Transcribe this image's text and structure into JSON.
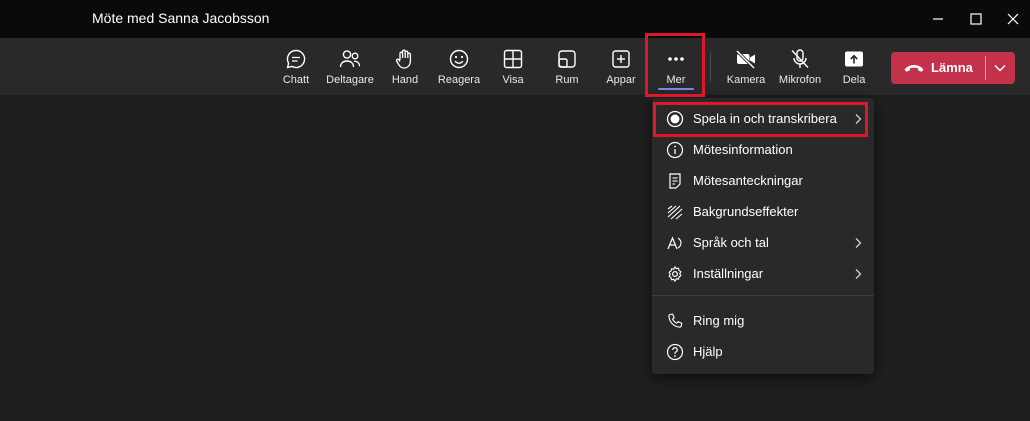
{
  "window": {
    "title": "Möte med Sanna Jacobsson"
  },
  "toolbar": {
    "chat": "Chatt",
    "participants": "Deltagare",
    "hand": "Hand",
    "react": "Reagera",
    "view": "Visa",
    "rooms": "Rum",
    "apps": "Appar",
    "more": "Mer",
    "camera": "Kamera",
    "mic": "Mikrofon",
    "share": "Dela",
    "leave": "Lämna"
  },
  "menu": {
    "items": [
      {
        "label": "Spela in och transkribera",
        "icon": "record-icon",
        "submenu": true
      },
      {
        "label": "Mötesinformation",
        "icon": "info-icon",
        "submenu": false
      },
      {
        "label": "Mötesanteckningar",
        "icon": "notes-icon",
        "submenu": false
      },
      {
        "label": "Bakgrundseffekter",
        "icon": "background-effects-icon",
        "submenu": false
      },
      {
        "label": "Språk och tal",
        "icon": "language-icon",
        "submenu": true
      },
      {
        "label": "Inställningar",
        "icon": "gear-icon",
        "submenu": true
      },
      {
        "label": "Ring mig",
        "icon": "phone-icon",
        "submenu": false
      },
      {
        "label": "Hjälp",
        "icon": "help-icon",
        "submenu": false
      }
    ]
  },
  "colors": {
    "leave": "#c4314b",
    "highlight": "#e0162b",
    "accent": "#7f85f5"
  }
}
